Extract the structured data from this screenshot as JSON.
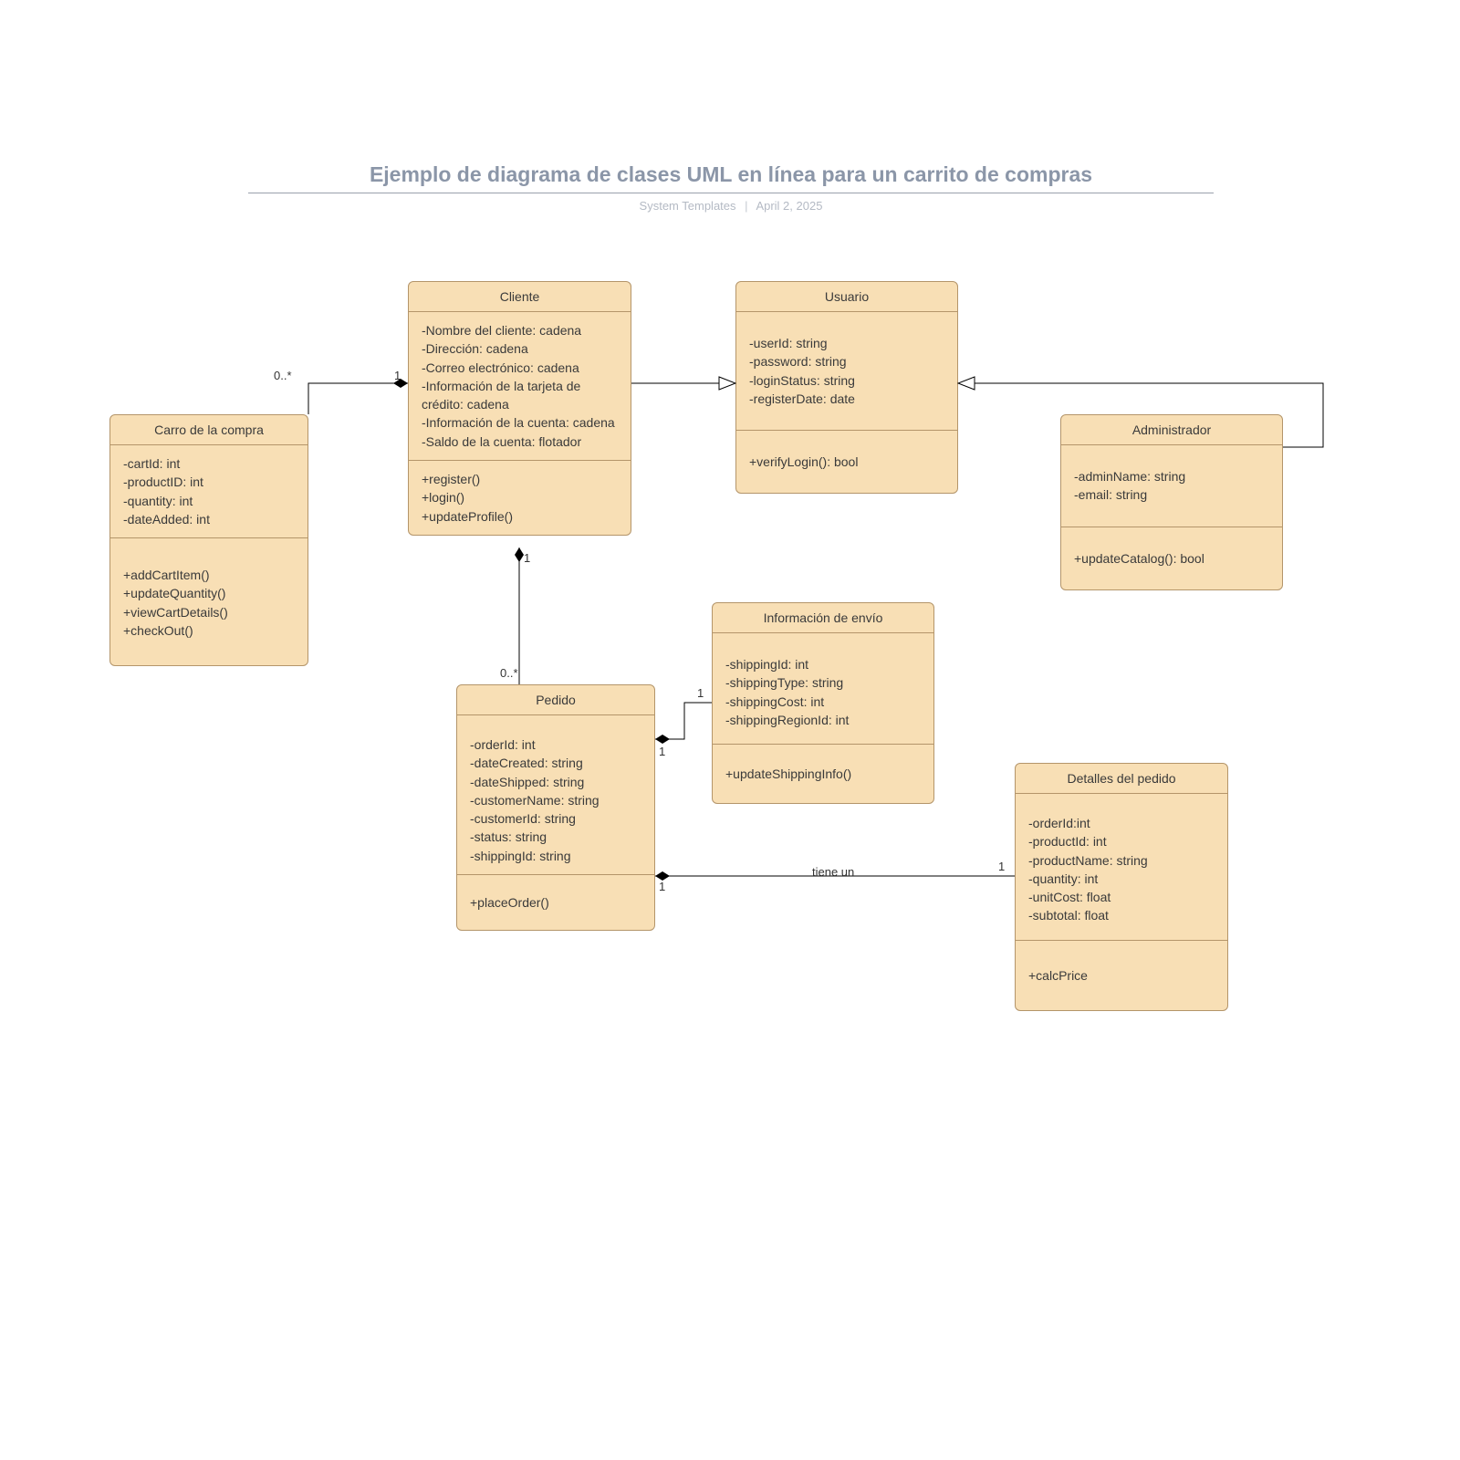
{
  "header": {
    "title": "Ejemplo de diagrama de clases UML en línea para un carrito de compras",
    "author": "System Templates",
    "date": "April 2, 2025"
  },
  "classes": {
    "cart": {
      "name": "Carro de la compra",
      "attrs": "-cartId: int\n-productID: int\n-quantity: int\n-dateAdded: int",
      "ops": "+addCartItem()\n+updateQuantity()\n+viewCartDetails()\n+checkOut()"
    },
    "cliente": {
      "name": "Cliente",
      "attrs": "-Nombre del cliente: cadena\n-Dirección: cadena\n-Correo electrónico: cadena\n-Información de la tarjeta de crédito: cadena\n-Información de la cuenta: cadena\n-Saldo de la cuenta: flotador",
      "ops": "+register()\n+login()\n+updateProfile()"
    },
    "usuario": {
      "name": "Usuario",
      "attrs": "-userId: string\n-password: string\n-loginStatus: string\n-registerDate: date",
      "ops": "+verifyLogin(): bool"
    },
    "admin": {
      "name": "Administrador",
      "attrs": "-adminName: string\n-email: string",
      "ops": "+updateCatalog(): bool"
    },
    "pedido": {
      "name": "Pedido",
      "attrs": "-orderId: int\n-dateCreated: string\n-dateShipped: string\n-customerName: string\n-customerId: string\n-status: string\n-shippingId: string",
      "ops": "+placeOrder()"
    },
    "envio": {
      "name": "Información de envío",
      "attrs": "-shippingId: int\n-shippingType: string\n-shippingCost: int\n-shippingRegionId: int",
      "ops": "+updateShippingInfo()"
    },
    "detalles": {
      "name": "Detalles del pedido",
      "attrs": "-orderId:int\n-productId: int\n-productName: string\n-quantity: int\n-unitCost: float\n-subtotal: float",
      "ops": "+calcPrice"
    }
  },
  "labels": {
    "one_a": "1",
    "one_b": "1",
    "one_c": "1",
    "one_d": "1",
    "one_e": "1",
    "one_f": "1",
    "zm_a": "0..*",
    "zm_b": "0..*",
    "tiene": "tiene un"
  }
}
